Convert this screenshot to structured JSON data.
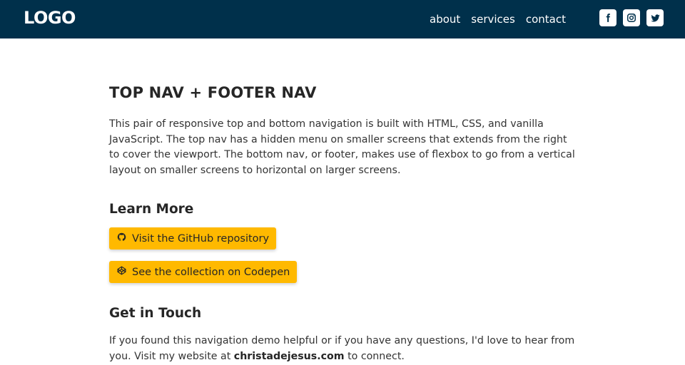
{
  "header": {
    "logo": "LOGO",
    "nav": [
      "about",
      "services",
      "contact"
    ],
    "social_icons": [
      "facebook-icon",
      "instagram-icon",
      "twitter-icon"
    ],
    "background": "#00304b"
  },
  "main": {
    "title": "TOP NAV + FOOTER NAV",
    "intro": "This pair of responsive top and bottom navigation is built with HTML, CSS, and vanilla JavaScript. The top nav has a hidden menu on smaller screens that extends from the right to cover the viewport. The bottom nav, or footer, makes use of flexbox to go from a vertical layout on smaller screens to horizontal on larger screens.",
    "learn_more": {
      "heading": "Learn More",
      "buttons": [
        {
          "label": "Visit the GitHub repository",
          "icon": "github-icon"
        },
        {
          "label": "See the collection on Codepen",
          "icon": "codepen-icon"
        }
      ],
      "button_color": "#ffb900"
    },
    "get_in_touch": {
      "heading": "Get in Touch",
      "text_before": "If you found this navigation demo helpful or if you have any questions, I'd love to hear from you. Visit my website at ",
      "link": "christadejesus.com",
      "text_after": " to connect."
    }
  }
}
